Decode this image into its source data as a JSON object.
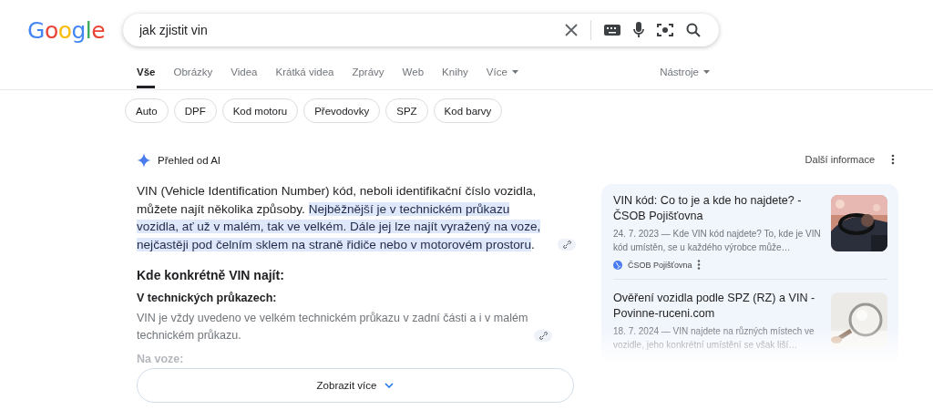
{
  "logo": "Google",
  "search": {
    "value": "jak zjistit vin"
  },
  "tabs": [
    {
      "label": "Vše",
      "selected": true
    },
    {
      "label": "Obrázky",
      "selected": false
    },
    {
      "label": "Videa",
      "selected": false
    },
    {
      "label": "Krátká videa",
      "selected": false
    },
    {
      "label": "Zprávy",
      "selected": false
    },
    {
      "label": "Web",
      "selected": false
    },
    {
      "label": "Knihy",
      "selected": false
    },
    {
      "label": "Více",
      "selected": false,
      "kind": "dropdown"
    }
  ],
  "tools": "Nástroje",
  "chips": [
    "Auto",
    "DPF",
    "Kod motoru",
    "Převodovky",
    "SPZ",
    "Kod barvy"
  ],
  "ai_overview": {
    "title": "Přehled od AI",
    "more_info": "Další informace",
    "paragraph": [
      {
        "text": "VIN (Vehicle Identification Number) kód, neboli identifikační číslo vozidla, můžete najít několika způsoby. ",
        "highlighted": false
      },
      {
        "text": "Nejběžnější je v technickém průkazu vozidla, ať už v malém, tak ve velkém. ",
        "highlighted": true
      },
      {
        "text": "Dále jej lze najít vyražený na voze, nejčastěji pod čelním sklem na straně řidiče nebo v motorovém prostoru",
        "highlighted": true
      },
      {
        "text": ".",
        "highlighted": false
      }
    ],
    "heading": "Kde konkrétně VIN najít:",
    "subheading": "V technických průkazech:",
    "body": "VIN je vždy uvedeno ve velkém technickém průkazu v zadní části a i v malém technickém průkazu.",
    "faded_heading": "Na voze:",
    "show_more": "Zobrazit více"
  },
  "sources": [
    {
      "title": "VIN kód: Co to je a kde ho najdete? - ČSOB Pojišťovna",
      "snippet": "24. 7. 2023 — Kde VIN kód najdete? To, kde je VIN kód umístěn, se u každého výrobce může…",
      "site": "ČSOB Pojišťovna",
      "kind": "car"
    },
    {
      "title": "Ověření vozidla podle SPZ (RZ) a VIN - Povinne-ruceni.com",
      "snippet": "18. 7. 2024 — VIN najdete na různých místech ve vozidle, jeho konkrétní umístění se však liší…",
      "kind": "magnifier"
    }
  ]
}
